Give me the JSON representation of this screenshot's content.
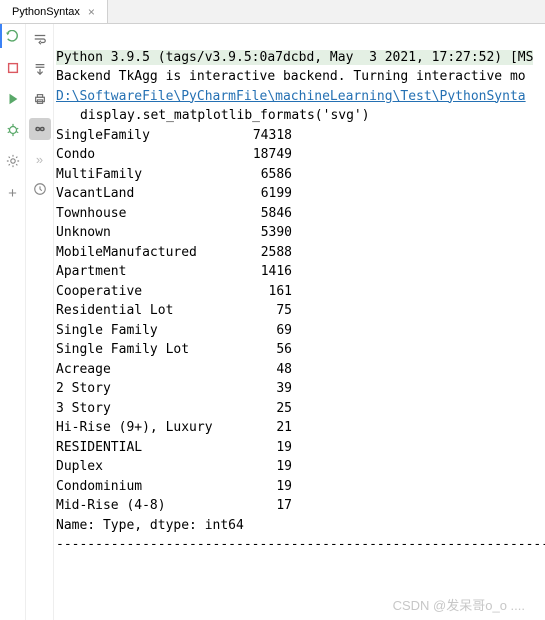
{
  "tab": {
    "title": "PythonSyntax"
  },
  "console": {
    "header": "Python 3.9.5 (tags/v3.9.5:0a7dcbd, May  3 2021, 17:27:52) [MS",
    "backend": "Backend TkAgg is interactive backend. Turning interactive mo",
    "path": "D:\\SoftwareFile\\PyCharmFile\\machineLearning\\Test\\PythonSynta",
    "indent_line": "display.set_matplotlib_formats('svg')",
    "footer": "Name: Type, dtype: int64",
    "divider": "----------------------------------------------------------------"
  },
  "rows": [
    {
      "label": "SingleFamily",
      "value": "74318"
    },
    {
      "label": "Condo",
      "value": "18749"
    },
    {
      "label": "MultiFamily",
      "value": "6586"
    },
    {
      "label": "VacantLand",
      "value": "6199"
    },
    {
      "label": "Townhouse",
      "value": "5846"
    },
    {
      "label": "Unknown",
      "value": "5390"
    },
    {
      "label": "MobileManufactured",
      "value": "2588"
    },
    {
      "label": "Apartment",
      "value": "1416"
    },
    {
      "label": "Cooperative",
      "value": "161"
    },
    {
      "label": "Residential Lot",
      "value": "75"
    },
    {
      "label": "Single Family",
      "value": "69"
    },
    {
      "label": "Single Family Lot",
      "value": "56"
    },
    {
      "label": "Acreage",
      "value": "48"
    },
    {
      "label": "2 Story",
      "value": "39"
    },
    {
      "label": "3 Story",
      "value": "25"
    },
    {
      "label": "Hi-Rise (9+), Luxury",
      "value": "21"
    },
    {
      "label": "RESIDENTIAL",
      "value": "19"
    },
    {
      "label": "Duplex",
      "value": "19"
    },
    {
      "label": "Condominium",
      "value": "19"
    },
    {
      "label": "Mid-Rise (4-8)",
      "value": "17"
    }
  ],
  "watermark": "CSDN @发呆哥o_o ...."
}
